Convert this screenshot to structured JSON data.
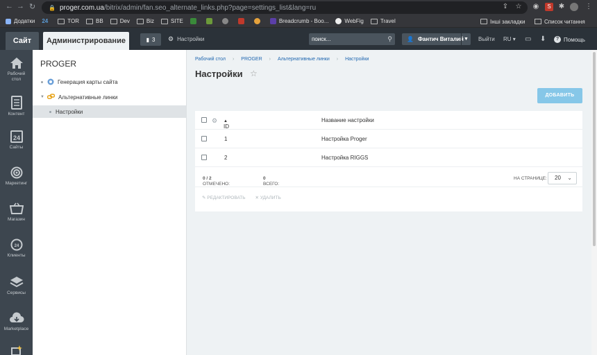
{
  "browser": {
    "url_host": "proger.com.ua",
    "url_path": "/bitrix/admin/fan.seo_alternate_links.php?page=settings_list&lang=ru",
    "bookmarks": [
      "Додатки",
      "TOR",
      "BB",
      "Dev",
      "Biz",
      "SITE",
      "Breadcrumb - Boo...",
      "WebFig",
      "Travel"
    ],
    "bookmarks_right": [
      "Інші закладки",
      "Список читання"
    ]
  },
  "adminbar": {
    "tab_site": "Сайт",
    "tab_admin": "Администрирование",
    "notifications_count": "3",
    "settings_label": "Настройки",
    "search_placeholder": "поиск...",
    "user_name": "Фантич Виталий",
    "logout": "Выйти",
    "lang": "RU",
    "help": "Помощь"
  },
  "leftnav": [
    {
      "label": "Рабочий стол",
      "label2": "",
      "icon": "home-icon"
    },
    {
      "label": "Контент",
      "icon": "content-icon"
    },
    {
      "label": "Сайты",
      "icon": "calendar-icon"
    },
    {
      "label": "Маркетинг",
      "icon": "target-icon"
    },
    {
      "label": "Магазин",
      "icon": "cart-icon"
    },
    {
      "label": "Клиенты",
      "icon": "clients-icon"
    },
    {
      "label": "Сервисы",
      "icon": "layers-icon"
    },
    {
      "label": "Marketplace",
      "icon": "cloud-download-icon"
    }
  ],
  "menu": {
    "title": "PROGER",
    "items": [
      "Генерация карты сайта",
      "Альтернативные линки",
      "Настройки"
    ]
  },
  "breadcrumb": [
    "Рабочий стол",
    "PROGER",
    "Альтернативные линки",
    "Настройки"
  ],
  "page": {
    "title": "Настройки",
    "add_button": "ДОБАВИТЬ"
  },
  "grid": {
    "columns": {
      "id": "ID",
      "name": "Название настройки"
    },
    "rows": [
      {
        "id": "1",
        "name": "Настройка Proger"
      },
      {
        "id": "2",
        "name": "Настройка RIGGS"
      }
    ],
    "footer": {
      "marked_label": "ОТМЕЧЕНО:",
      "marked_value": "0 / 2",
      "total_label": "ВСЕГО:",
      "total_value": "0",
      "per_page_label": "НА СТРАНИЦЕ:",
      "per_page_value": "20"
    },
    "actions": {
      "edit": "РЕДАКТИРОВАТЬ",
      "delete": "УДАЛИТЬ"
    }
  }
}
